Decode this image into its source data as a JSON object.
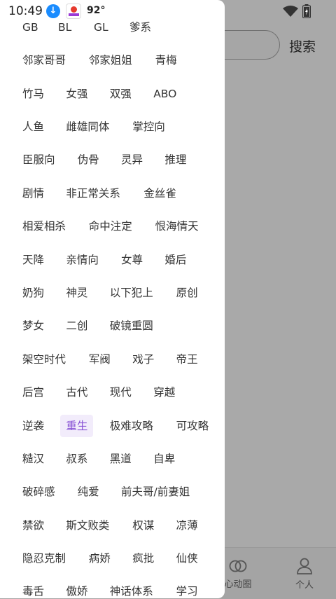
{
  "status_bar": {
    "time": "10:49",
    "temperature": "92°",
    "download_icon_glyph": "↓"
  },
  "background": {
    "search_button_label": "搜索",
    "nav": {
      "heart_label": "心动圈",
      "me_label": "个人"
    }
  },
  "drawer": {
    "selected_tag": "重生",
    "rows": [
      [
        "GB",
        "BL",
        "GL",
        "爹系"
      ],
      [
        "邻家哥哥",
        "邻家姐姐",
        "青梅"
      ],
      [
        "竹马",
        "女强",
        "双强",
        "ABO"
      ],
      [
        "人鱼",
        "雌雄同体",
        "掌控向"
      ],
      [
        "臣服向",
        "伪骨",
        "灵异",
        "推理"
      ],
      [
        "剧情",
        "非正常关系",
        "金丝雀"
      ],
      [
        "相爱相杀",
        "命中注定",
        "恨海情天"
      ],
      [
        "天降",
        "亲情向",
        "女尊",
        "婚后"
      ],
      [
        "奶狗",
        "神灵",
        "以下犯上",
        "原创"
      ],
      [
        "梦女",
        "二创",
        "破镜重圆"
      ],
      [
        "架空时代",
        "军阀",
        "戏子",
        "帝王"
      ],
      [
        "后宫",
        "古代",
        "现代",
        "穿越"
      ],
      [
        "逆袭",
        "重生",
        "极难攻略",
        "可攻略"
      ],
      [
        "糙汉",
        "叔系",
        "黑道",
        "自卑"
      ],
      [
        "破碎感",
        "纯爱",
        "前夫哥/前妻姐"
      ],
      [
        "禁欲",
        "斯文败类",
        "权谋",
        "凉薄"
      ],
      [
        "隐忍克制",
        "病娇",
        "疯批",
        "仙侠"
      ],
      [
        "毒舌",
        "傲娇",
        "神话体系",
        "学习"
      ]
    ]
  },
  "colors": {
    "selected_text": "#8a55d6",
    "selected_bg": "#f2ecfb",
    "overlay": "#a9a9a9"
  }
}
